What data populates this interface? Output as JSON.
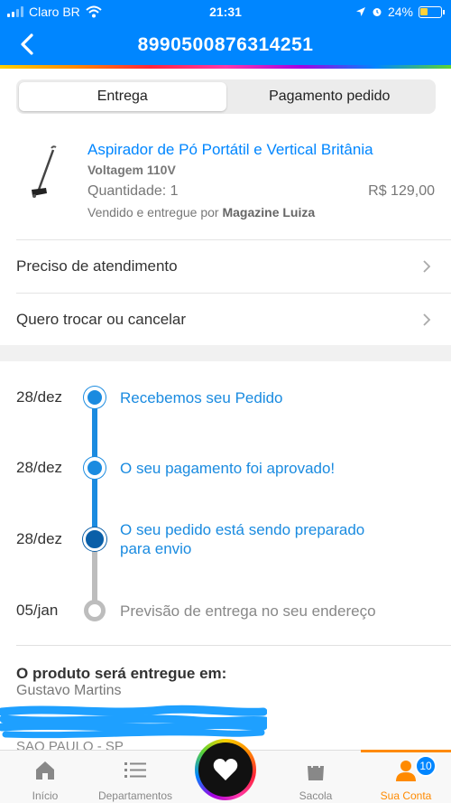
{
  "status_bar": {
    "carrier": "Claro BR",
    "time": "21:31",
    "battery": "24%"
  },
  "header": {
    "order_number": "8990500876314251",
    "back_icon": "chevron-left-icon"
  },
  "tabs": [
    {
      "label": "Entrega",
      "active": true
    },
    {
      "label": "Pagamento pedido",
      "active": false
    }
  ],
  "product": {
    "name": "Aspirador de Pó Portátil e Vertical Britânia",
    "voltage": "Voltagem 110V",
    "quantity": "Quantidade: 1",
    "price": "R$ 129,00",
    "seller_prefix": "Vendido e entregue por",
    "seller": "Magazine Luiza"
  },
  "actions": [
    {
      "label": "Preciso de atendimento"
    },
    {
      "label": "Quero trocar ou cancelar"
    }
  ],
  "timeline": [
    {
      "date": "28/dez",
      "text": "Recebemos seu Pedido",
      "state": "done"
    },
    {
      "date": "28/dez",
      "text": "O seu pagamento foi aprovado!",
      "state": "done"
    },
    {
      "date": "28/dez",
      "text_line1": "O seu pedido está sendo preparado",
      "text_line2": "para envio",
      "state": "current"
    },
    {
      "date": "05/jan",
      "text": "Previsão de entrega no seu endereço",
      "state": "pending"
    }
  ],
  "delivery": {
    "title": "O produto será entregue em:",
    "name": "Gustavo Martins",
    "city": "SAO PAULO - SP"
  },
  "tabbar": [
    {
      "label": "Início",
      "icon": "home-icon"
    },
    {
      "label": "Departamentos",
      "icon": "menu-icon"
    },
    {
      "label": "",
      "icon": "heart-icon"
    },
    {
      "label": "Sacola",
      "icon": "bag-icon"
    },
    {
      "label": "Sua Conta",
      "icon": "user-icon",
      "badge": "10",
      "active": true
    }
  ],
  "colors": {
    "primary": "#0086ff",
    "active_tab": "#ff8a00",
    "timeline_current": "#0a5fa8",
    "timeline_pending": "#bdbdbd"
  }
}
